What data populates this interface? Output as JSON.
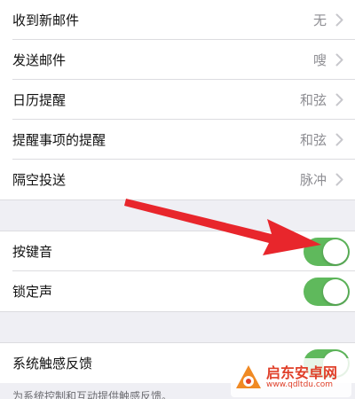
{
  "sounds_list": {
    "items": [
      {
        "label": "收到新邮件",
        "value": "无"
      },
      {
        "label": "发送邮件",
        "value": "嗖"
      },
      {
        "label": "日历提醒",
        "value": "和弦"
      },
      {
        "label": "提醒事项的提醒",
        "value": "和弦"
      },
      {
        "label": "隔空投送",
        "value": "脉冲"
      }
    ]
  },
  "toggles": {
    "keyboard_clicks": {
      "label": "按键音",
      "on": true
    },
    "lock_sound": {
      "label": "锁定声",
      "on": true
    }
  },
  "haptics": {
    "label": "系统触感反馈",
    "on": true,
    "footer": "为系统控制和互动提供触感反馈。"
  },
  "colors": {
    "toggle_on": "#5fb95c",
    "annotation_arrow": "#e8262c"
  },
  "watermark": {
    "title": "启东安卓网",
    "url": "www.qdltdu.com"
  }
}
